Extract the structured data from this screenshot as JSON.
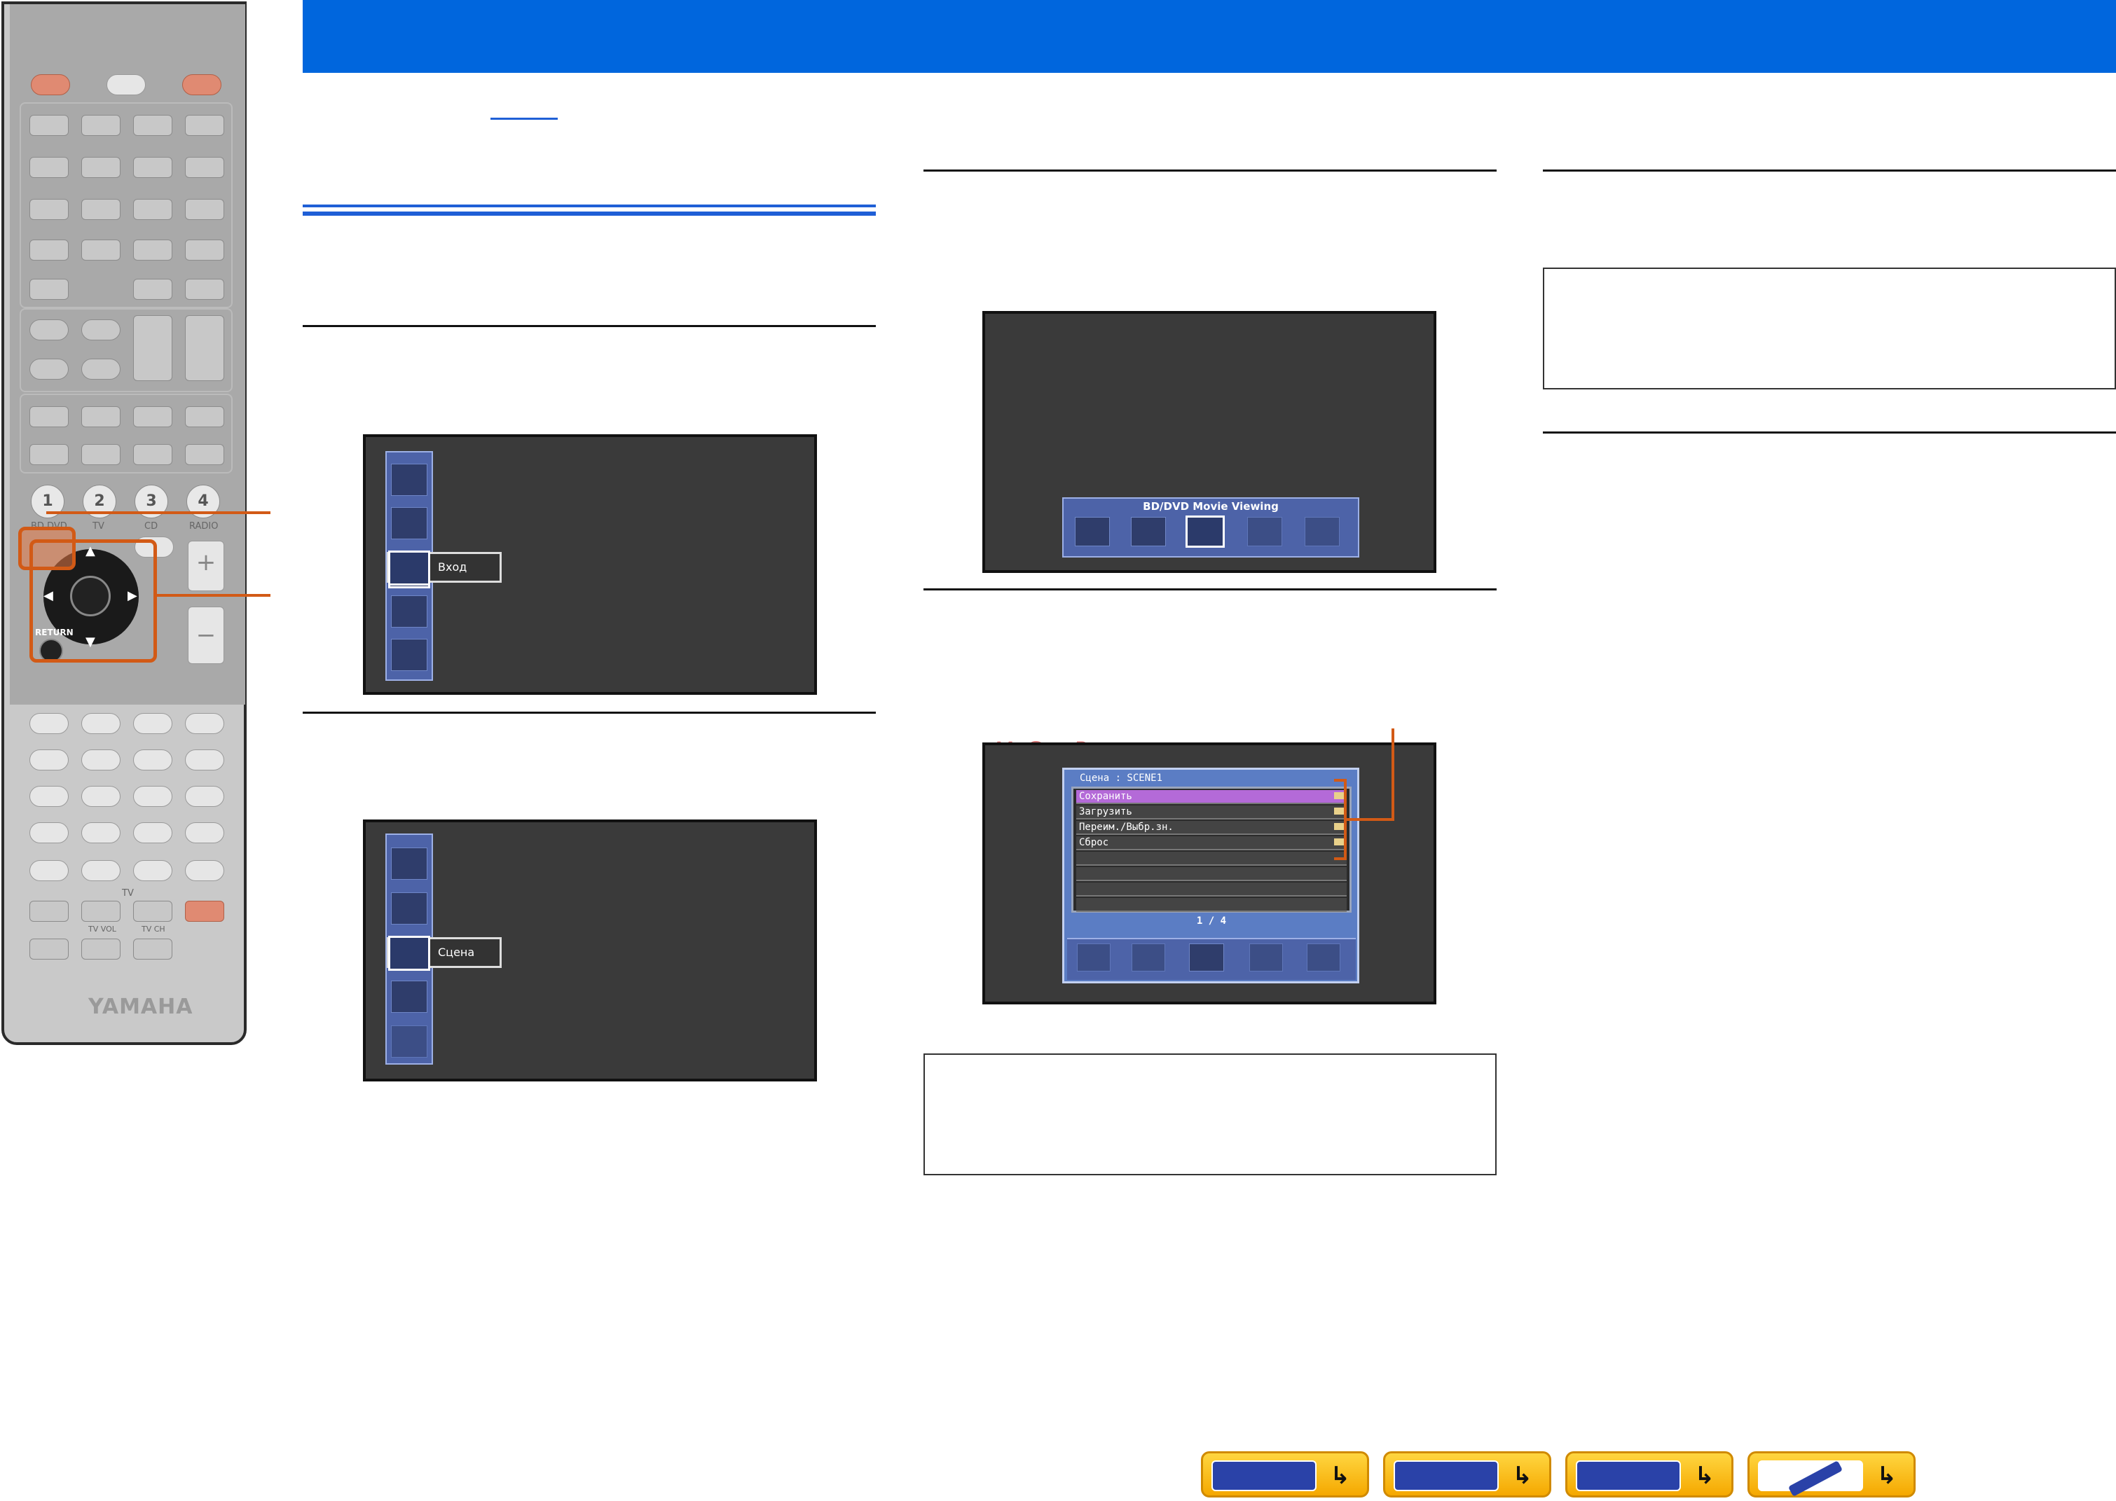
{
  "remote": {
    "numbers": [
      "1",
      "2",
      "3",
      "4"
    ],
    "scene_labels": [
      "BD DVD",
      "TV",
      "CD",
      "RADIO"
    ],
    "return_label": "RETURN",
    "tv_label": "TV",
    "tv_vol_label": "TV VOL",
    "tv_ch_label": "TV CH",
    "brand": "YAMAHA",
    "plus": "+",
    "minus": "−"
  },
  "screen1": {
    "selected_label": "Вход"
  },
  "screen2": {
    "selected_label": "Сцена"
  },
  "screen3": {
    "title": "BD/DVD Movie Viewing",
    "icons": [
      "scene-1",
      "scene-2",
      "movie",
      "receiver",
      "disc"
    ]
  },
  "screen4": {
    "header": "Сцена : SCENE1",
    "items": [
      "Сохранить",
      "Загрузить",
      "Переим./Выбр.зн.",
      "Сброс"
    ],
    "page": "1 / 4"
  },
  "watermark": "McGrp.Ru",
  "colors": {
    "banner": "#0066dd",
    "highlight": "#d25a16",
    "menu_highlight": "#b46ad8",
    "nav": "#f5b800"
  }
}
